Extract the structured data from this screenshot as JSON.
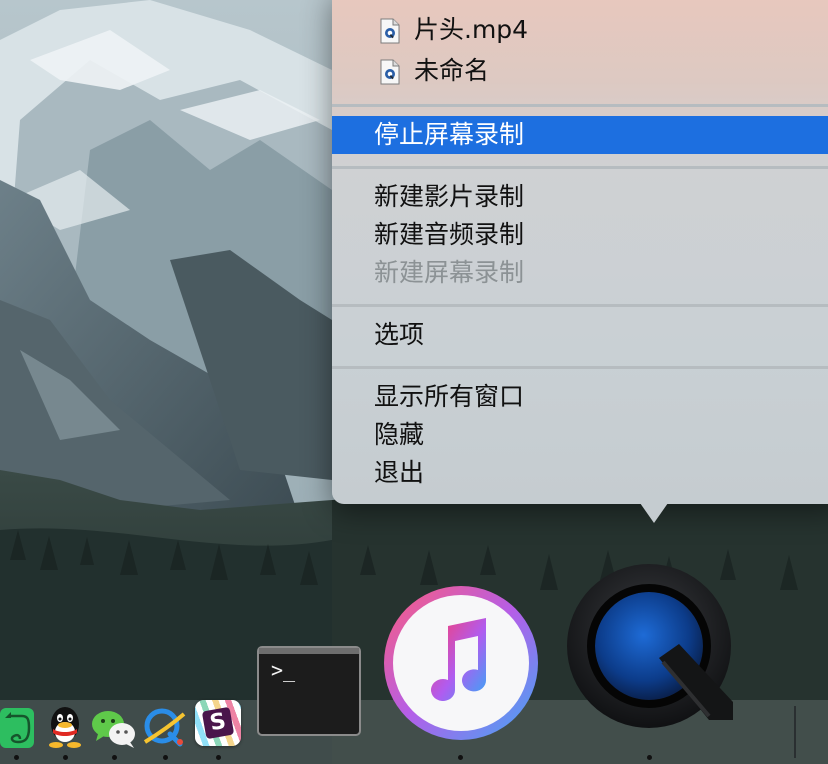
{
  "menu": {
    "files": [
      {
        "label": "片头.mp4",
        "icon": "quicktime-file-icon"
      },
      {
        "label": "未命名",
        "icon": "quicktime-file-icon"
      }
    ],
    "selected_item": "停止屏幕录制",
    "new_items": [
      {
        "label": "新建影片录制",
        "enabled": true
      },
      {
        "label": "新建音频录制",
        "enabled": true
      },
      {
        "label": "新建屏幕录制",
        "enabled": false
      }
    ],
    "options_item": "选项",
    "window_items": [
      {
        "label": "显示所有窗口"
      },
      {
        "label": "隐藏"
      },
      {
        "label": "退出"
      }
    ],
    "selection_color": "#1d6fe0"
  },
  "dock": {
    "apps": [
      "evernote-icon",
      "qq-icon",
      "wechat-icon",
      "qq-browser-icon",
      "slack-icon",
      "terminal-icon",
      "itunes-icon",
      "quicktime-icon"
    ],
    "terminal_prompt": ">_",
    "slack_letter": "S"
  }
}
